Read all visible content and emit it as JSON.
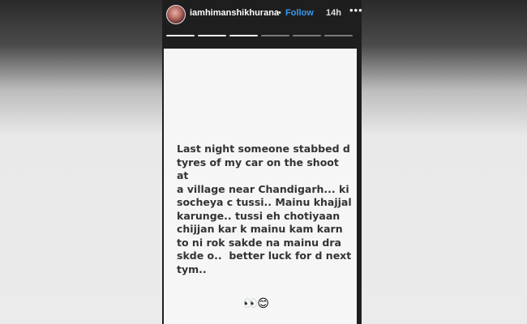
{
  "header": {
    "username": "iamhimanshikhurana",
    "separator": "•",
    "follow_label": "Follow",
    "time": "14h",
    "more_label": "•••"
  },
  "story": {
    "text": "Last night someone stabbed d\ntyres of my car on the shoot at\na village near Chandigarh... ki\nsocheya c tussi.. Mainu khajjal\nkarunge.. tussi eh chotiyaan\nchijjan kar k mainu kam karn\nto ni rok sakde na mainu dra\nskde o..  better luck for d next\ntym..",
    "emojis": "👀😊"
  },
  "icons": {
    "avatar": "avatar-icon"
  },
  "colors": {
    "follow": "#3897f0",
    "story_bg": "#1e1e1e",
    "card_bg": "#f6f6f6",
    "text": "#333333"
  },
  "progress": {
    "total_segments": 6,
    "viewed_segments": 3
  }
}
